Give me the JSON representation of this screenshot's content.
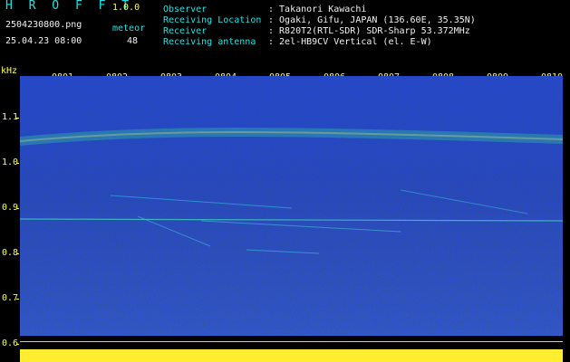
{
  "header": {
    "app_title": "H R O F F T",
    "version": "1.0.0",
    "filename": "2504230800.png",
    "datetime": "25.04.23 08:00",
    "meteor_label": "meteor",
    "meteor_count": "48",
    "info": [
      {
        "key": "Observer",
        "value": ": Takanori Kawachi"
      },
      {
        "key": "Receiving Location",
        "value": ": Ogaki, Gifu, JAPAN (136.60E, 35.35N)"
      },
      {
        "key": "Receiver",
        "value": ": R820T2(RTL-SDR) SDR-Sharp 53.372MHz"
      },
      {
        "key": "Receiving antenna",
        "value": ": 2el-HB9CV Vertical (el. E-W)"
      }
    ]
  },
  "axis": {
    "unit": "kHz",
    "y_labels": [
      "1.1",
      "1.0",
      "0.9",
      "0.8",
      "0.7",
      "0.6"
    ],
    "time_labels": [
      "0801",
      "0802",
      "0803",
      "0804",
      "0805",
      "0806",
      "0807",
      "0808",
      "0809",
      "0810"
    ]
  },
  "colors": {
    "background": "#000000",
    "header_text": "#19e6e6",
    "value_text": "#f0f0f0",
    "axis_text": "#ffff40",
    "spectrum_base": "#0a1a90"
  }
}
